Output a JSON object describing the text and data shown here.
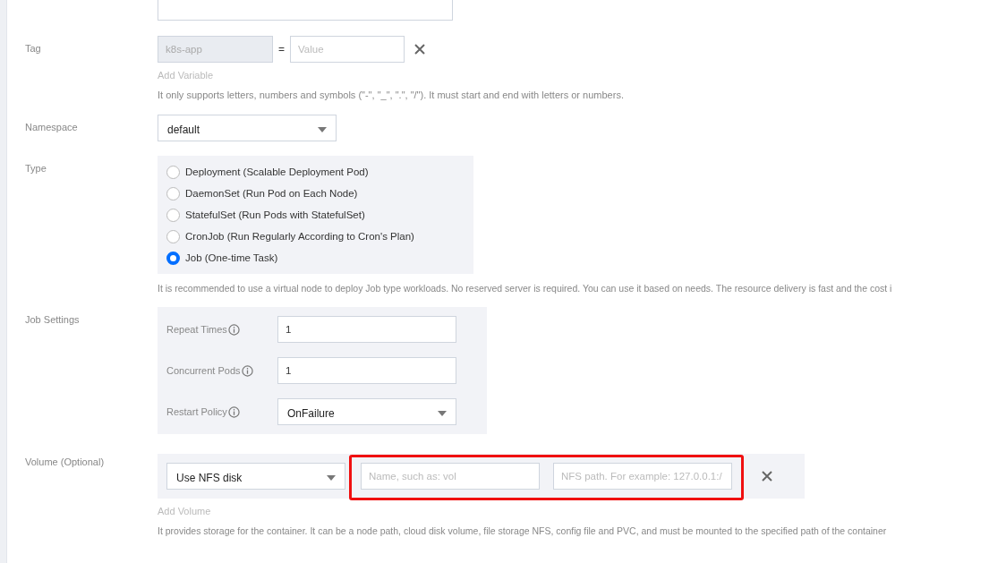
{
  "tag": {
    "label": "Tag",
    "key": "k8s-app",
    "separator": "=",
    "value_placeholder": "Value",
    "add_link": "Add Variable",
    "hint": "It only supports letters, numbers and symbols (\"-\", \"_\", \".\", \"/\"). It must start and end with letters or numbers."
  },
  "namespace": {
    "label": "Namespace",
    "value": "default"
  },
  "type": {
    "label": "Type",
    "options": [
      {
        "label": "Deployment (Scalable Deployment Pod)",
        "selected": false
      },
      {
        "label": "DaemonSet (Run Pod on Each Node)",
        "selected": false
      },
      {
        "label": "StatefulSet (Run Pods with StatefulSet)",
        "selected": false
      },
      {
        "label": "CronJob (Run Regularly According to Cron's Plan)",
        "selected": false
      },
      {
        "label": "Job (One-time Task)",
        "selected": true
      }
    ],
    "hint": "It is recommended to use a virtual node to deploy Job type workloads. No reserved server is required. You can use it based on needs. The resource delivery is fast and the cost i"
  },
  "job_settings": {
    "label": "Job Settings",
    "fields": [
      {
        "label": "Repeat Times",
        "kind": "input",
        "value": "1"
      },
      {
        "label": "Concurrent Pods",
        "kind": "input",
        "value": "1"
      },
      {
        "label": "Restart Policy",
        "kind": "select",
        "value": "OnFailure"
      }
    ]
  },
  "volume": {
    "label": "Volume (Optional)",
    "source": "Use NFS disk",
    "name_placeholder": "Name, such as: vol",
    "path_placeholder": "NFS path. For example: 127.0.0.1:/",
    "highlighted": true,
    "add_link": "Add Volume",
    "hint": "It provides storage for the container. It can be a node path, cloud disk volume, file storage NFS, config file and PVC, and must be mounted to the specified path of the container"
  }
}
